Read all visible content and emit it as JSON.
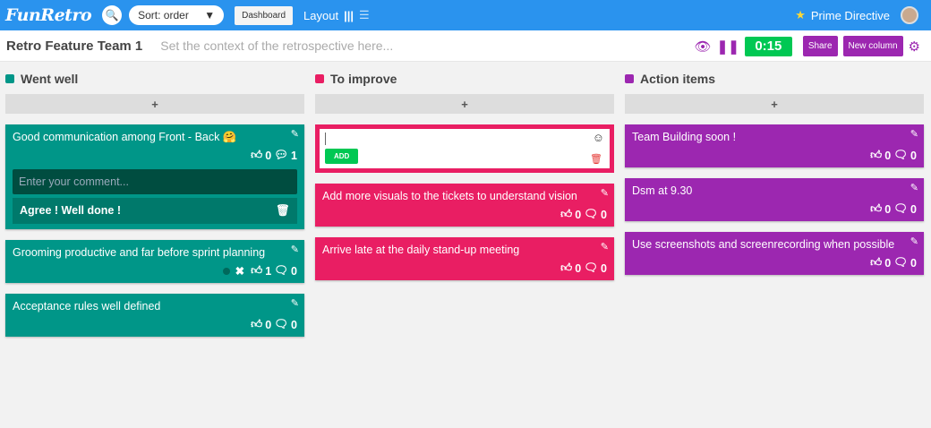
{
  "topbar": {
    "logo": "FunRetro",
    "sort": "Sort: order",
    "dashboard": "Dashboard",
    "layout": "Layout",
    "prime": "Prime Directive"
  },
  "board": {
    "title": "Retro Feature Team 1",
    "context_placeholder": "Set the context of the retrospective here...",
    "timer": "0:15",
    "share": "Share",
    "new_column": "New column"
  },
  "colors": {
    "teal": "#009688",
    "pink": "#e91e63",
    "purple": "#9c27b0",
    "blue": "#2a93ee",
    "green": "#00c853"
  },
  "columns": [
    {
      "title": "Went well",
      "add": "+",
      "cards": [
        {
          "text": "Good communication among Front - Back 🤗",
          "likes": "0",
          "comments": "1",
          "comment_placeholder": "Enter your comment...",
          "comment": "Agree ! Well done !"
        },
        {
          "text": "Grooming productive and far before sprint planning",
          "likes": "1",
          "comments": "0"
        },
        {
          "text": "Acceptance rules well defined",
          "likes": "0",
          "comments": "0"
        }
      ]
    },
    {
      "title": "To improve",
      "add": "+",
      "new_card": {
        "add": "ADD"
      },
      "cards": [
        {
          "text": "Add more visuals to the tickets to understand vision",
          "likes": "0",
          "comments": "0"
        },
        {
          "text": "Arrive late at the daily stand-up meeting",
          "likes": "0",
          "comments": "0"
        }
      ]
    },
    {
      "title": "Action items",
      "add": "+",
      "cards": [
        {
          "text": "Team Building soon !",
          "likes": "0",
          "comments": "0"
        },
        {
          "text": "Dsm at 9.30",
          "likes": "0",
          "comments": "0"
        },
        {
          "text": "Use screenshots and screenrecording when possible",
          "likes": "0",
          "comments": "0"
        }
      ]
    }
  ]
}
